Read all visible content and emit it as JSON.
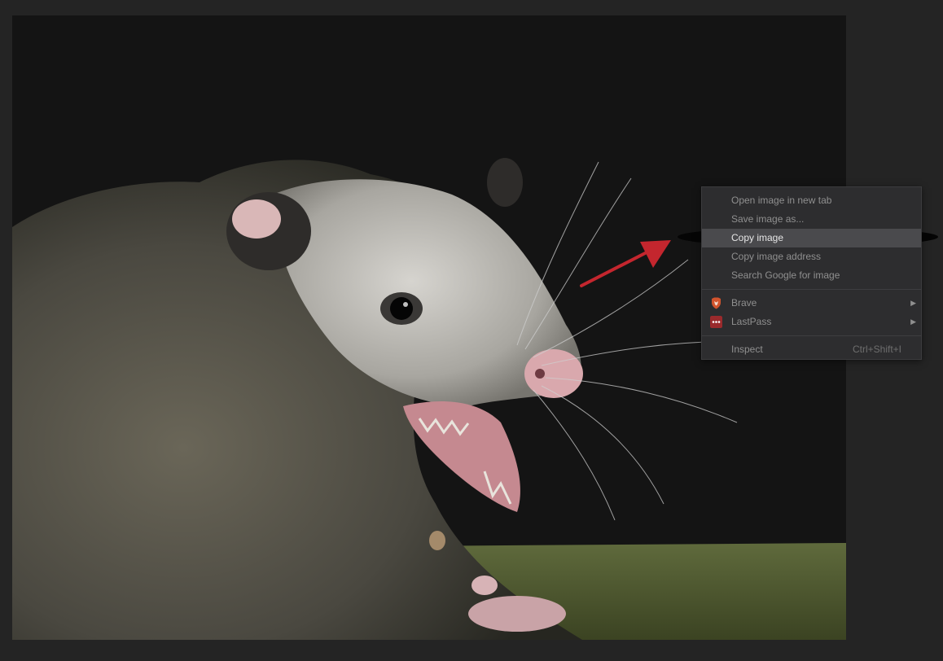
{
  "context_menu": {
    "items": [
      {
        "label": "Open image in new tab"
      },
      {
        "label": "Save image as..."
      },
      {
        "label": "Copy image",
        "highlighted": true
      },
      {
        "label": "Copy image address"
      },
      {
        "label": "Search Google for image"
      }
    ],
    "extensions": [
      {
        "label": "Brave",
        "icon": "brave-lion-icon"
      },
      {
        "label": "LastPass",
        "icon": "lastpass-icon"
      }
    ],
    "inspect": {
      "label": "Inspect",
      "shortcut": "Ctrl+Shift+I"
    }
  },
  "colors": {
    "background": "#242424",
    "menu_background": "#2d2d2f",
    "menu_highlight": "#4a4a4d",
    "arrow": "#c4262e"
  }
}
